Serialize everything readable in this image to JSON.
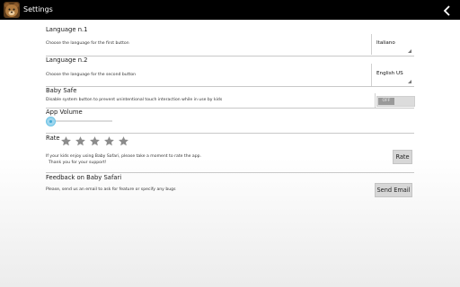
{
  "header": {
    "title": "Settings",
    "app_icon": "bear-app-icon",
    "back_icon": "chevron-left-icon"
  },
  "settings": {
    "language1": {
      "title": "Language n.1",
      "description": "Choose the language for the first button",
      "value": "Italiano"
    },
    "language2": {
      "title": "Language n.2",
      "description": "Choose the language for the second button",
      "value": "English US"
    },
    "baby_safe": {
      "title": "Baby Safe",
      "description": "Disable system button to prevent unintentional touch interaction while in use by kids",
      "toggle_label": "OFF",
      "enabled": false
    },
    "volume": {
      "title": "App Volume",
      "level": 0
    },
    "rate": {
      "title": "Rate",
      "stars_total": 5,
      "stars_filled": 0,
      "message_line1": "If your kids enjoy using Baby Safari, please take a moment to rate the app.",
      "message_line2": "Thank you for your support!",
      "button": "Rate"
    },
    "feedback": {
      "title": "Feedback on Baby Safari",
      "description": "Please, send us an email to ask for feature or specify any bugs",
      "button": "Send Email"
    }
  },
  "colors": {
    "topbar": "#000000",
    "slider_accent": "#6ec4e6",
    "star": "#8c8c8c",
    "button_bg": "#d7d7d7"
  }
}
